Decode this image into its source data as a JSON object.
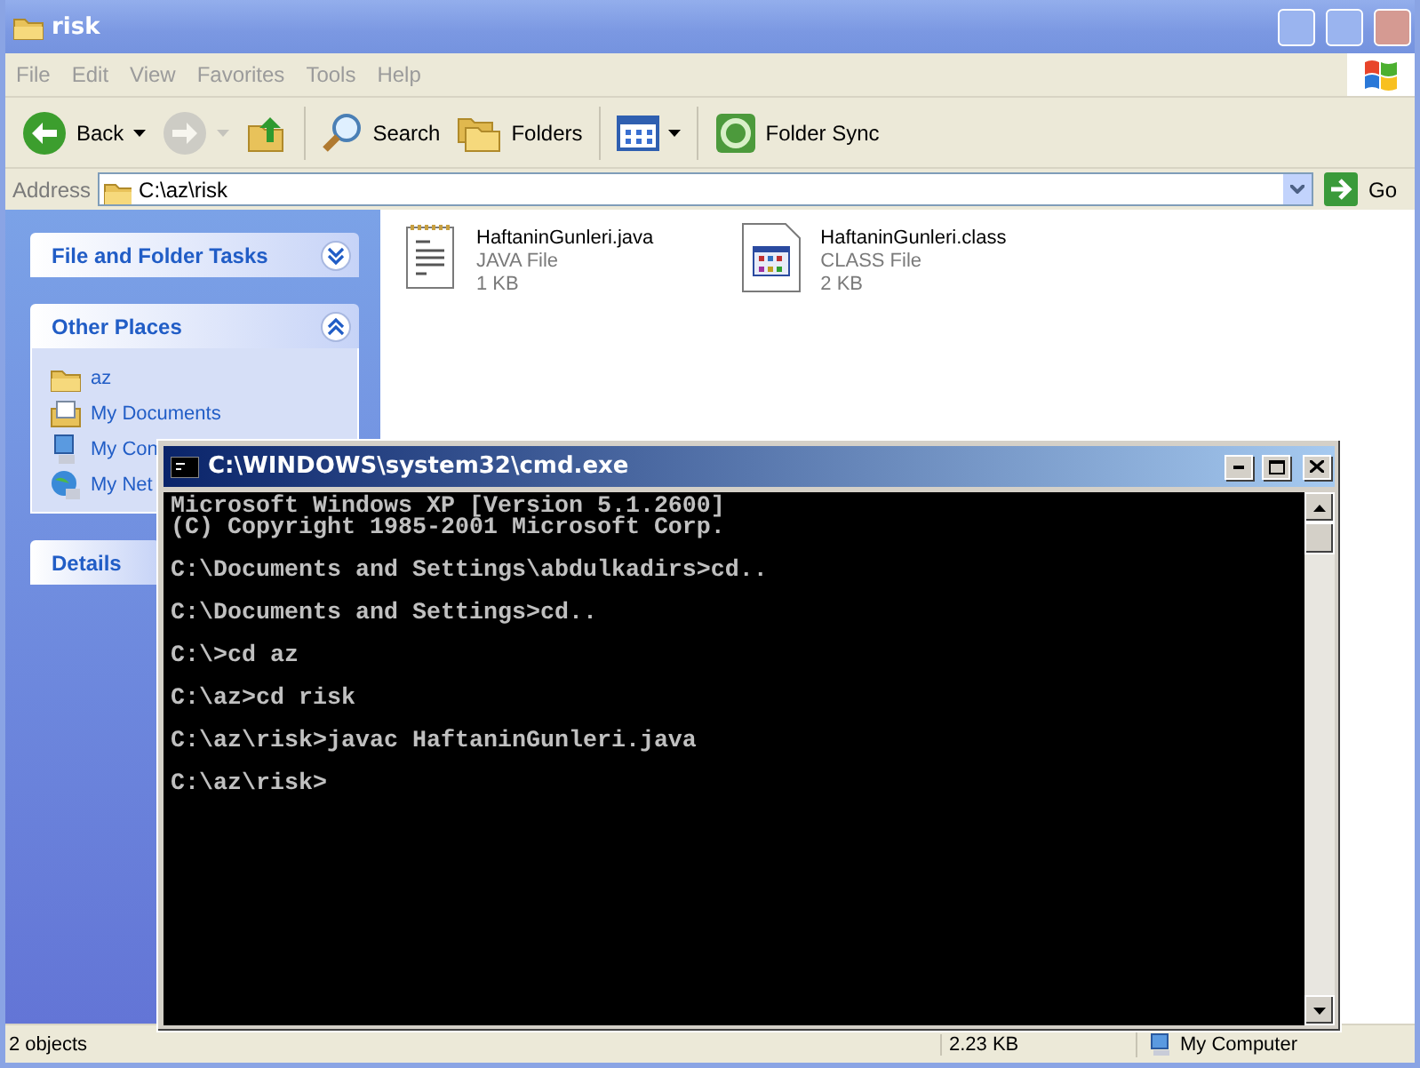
{
  "explorer": {
    "title": "risk",
    "menu": [
      "File",
      "Edit",
      "View",
      "Favorites",
      "Tools",
      "Help"
    ],
    "toolbar": [
      {
        "label": "Back",
        "dropdown": true,
        "disabled": false
      },
      {
        "dropdown": true,
        "disabled": true
      },
      {
        "dropdown": false,
        "disabled": false
      },
      {
        "label": "Search",
        "dropdown": false,
        "disabled": false
      },
      {
        "label": "Folders",
        "dropdown": false,
        "disabled": false
      },
      {
        "dropdown": true,
        "disabled": false
      },
      {
        "label": "Folder Sync",
        "dropdown": false,
        "disabled": false
      }
    ],
    "address": {
      "label": "Address",
      "value": "C:\\az\\risk",
      "go": "Go"
    },
    "sidebar": [
      {
        "title": "File and Folder Tasks",
        "expanded": false
      },
      {
        "title": "Other Places",
        "expanded": true,
        "items": [
          "az",
          "My Documents",
          "My Con",
          "My Net"
        ]
      },
      {
        "title": "Details"
      }
    ],
    "files": [
      {
        "name": "HaftaninGunleri.java",
        "type": "JAVA File",
        "size": "1 KB"
      },
      {
        "name": "HaftaninGunleri.class",
        "type": "CLASS File",
        "size": "2 KB"
      }
    ],
    "status_bar": [
      "2 objects",
      "2.23 KB",
      "My Computer"
    ]
  },
  "cmd": {
    "title": "C:\\WINDOWS\\system32\\cmd.exe",
    "blocks": [
      [
        "Microsoft Windows XP [Version 5.1.2600]",
        "(C) Copyright 1985-2001 Microsoft Corp."
      ],
      [
        "C:\\Documents and Settings\\abdulkadirs>cd.."
      ],
      [
        "C:\\Documents and Settings>cd.."
      ],
      [
        "C:\\>cd az"
      ],
      [
        "C:\\az>cd risk"
      ],
      [
        "C:\\az\\risk>javac HaftaninGunleri.java"
      ],
      [
        "C:\\az\\risk>"
      ]
    ]
  }
}
